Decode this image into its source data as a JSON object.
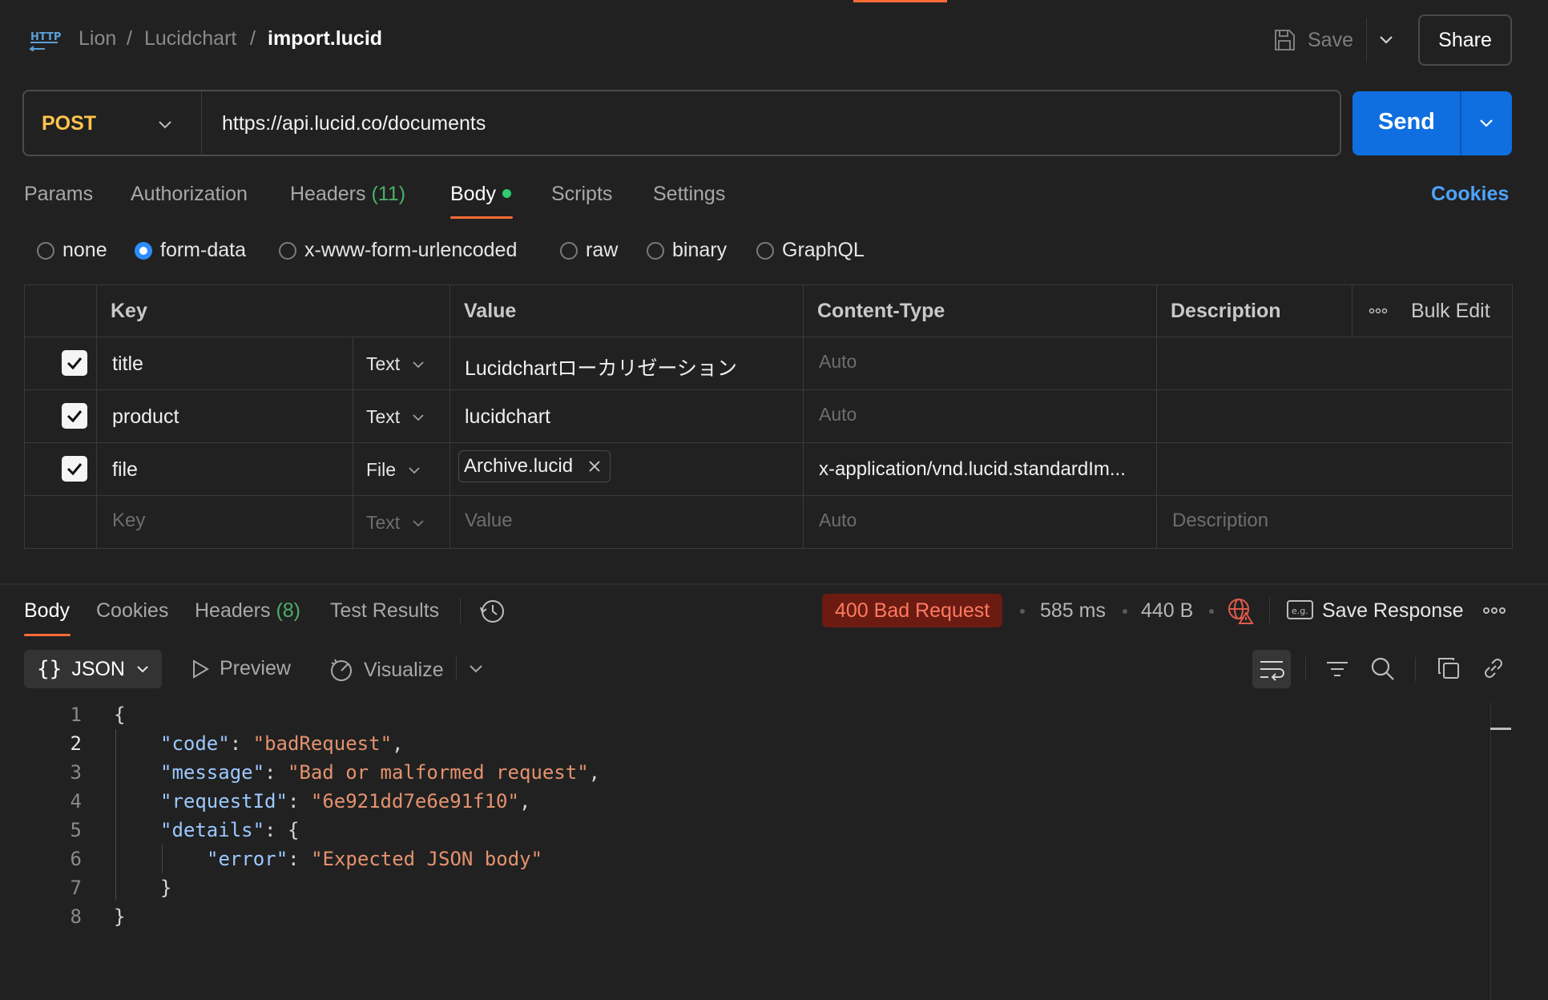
{
  "header": {
    "crumbs": [
      "Lion",
      "Lucidchart",
      "import.lucid"
    ],
    "crumb_sep": "/",
    "save_label": "Save",
    "share_label": "Share"
  },
  "request": {
    "method": "POST",
    "url": "https://api.lucid.co/documents",
    "send_label": "Send"
  },
  "tabs": {
    "params": "Params",
    "authorization": "Authorization",
    "headers": "Headers",
    "headers_count": "(11)",
    "body": "Body",
    "scripts": "Scripts",
    "settings": "Settings",
    "cookies": "Cookies",
    "active": "Body"
  },
  "body_modes": {
    "options": [
      "none",
      "form-data",
      "x-www-form-urlencoded",
      "raw",
      "binary",
      "GraphQL"
    ],
    "selected": "form-data"
  },
  "form_table": {
    "columns": [
      "Key",
      "Value",
      "Content-Type",
      "Description"
    ],
    "bulk_edit": "Bulk Edit",
    "rows": [
      {
        "checked": true,
        "key": "title",
        "type": "Text",
        "value": "Lucidchartローカリゼーション",
        "content_type": "Auto",
        "description": ""
      },
      {
        "checked": true,
        "key": "product",
        "type": "Text",
        "value": "lucidchart",
        "content_type": "Auto",
        "description": ""
      },
      {
        "checked": true,
        "key": "file",
        "type": "File",
        "value": "Archive.lucid",
        "content_type": "x-application/vnd.lucid.standardIm...",
        "description": ""
      }
    ],
    "placeholder_row": {
      "key": "Key",
      "type": "Text",
      "value": "Value",
      "content_type": "Auto",
      "description": "Description"
    }
  },
  "response": {
    "tabs": {
      "body": "Body",
      "cookies": "Cookies",
      "headers": "Headers",
      "headers_count": "(8)",
      "tests": "Test Results"
    },
    "status": "400 Bad Request",
    "time": "585 ms",
    "size": "440 B",
    "save_response": "Save Response",
    "format": "JSON",
    "preview": "Preview",
    "visualize": "Visualize",
    "code_lines": [
      "{",
      "\"code\": \"badRequest\",",
      "\"message\": \"Bad or malformed request\",",
      "\"requestId\": \"6e921dd7e6e91f10\",",
      "\"details\": {",
      "\"error\": \"Expected JSON body\"",
      "}",
      "}"
    ],
    "json": {
      "code": "badRequest",
      "message": "Bad or malformed request",
      "requestId": "6e921dd7e6e91f10",
      "details_error": "Expected JSON body"
    },
    "line_numbers": [
      "1",
      "2",
      "3",
      "4",
      "5",
      "6",
      "7",
      "8"
    ]
  },
  "colors": {
    "accent": "#ff6c37",
    "send": "#0f6fe0",
    "method": "#ffc44c",
    "link": "#4ea3ff",
    "status_bg": "#6b1b12",
    "status_text": "#ff7a5e"
  }
}
